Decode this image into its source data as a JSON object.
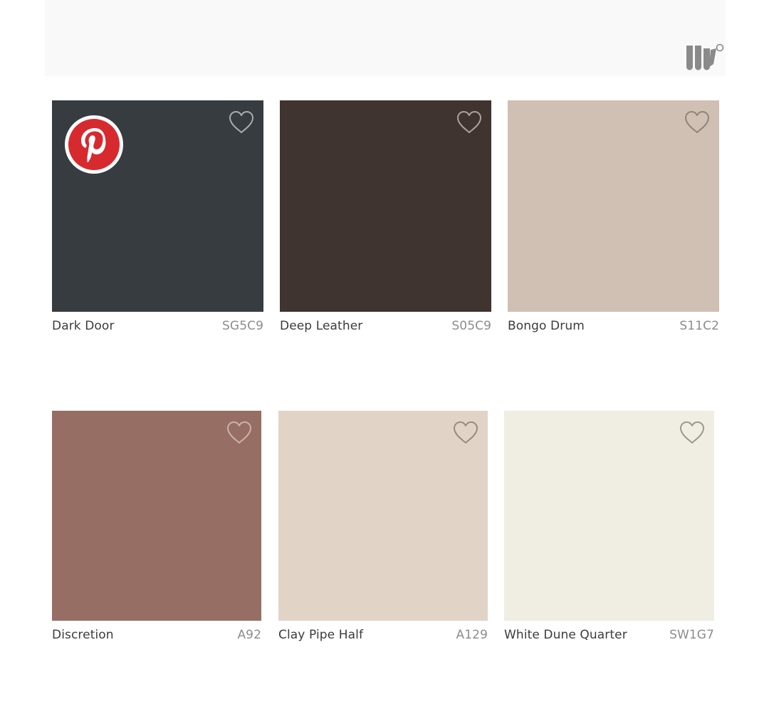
{
  "brand": {
    "logo_icon": "brand-logo-icon",
    "logo_color": "#8a8a8a"
  },
  "swatches": [
    {
      "name": "Dark Door",
      "code": "SG5C9",
      "hex": "#363c40",
      "heart_color": "#a9adb0",
      "pinterest": true
    },
    {
      "name": "Deep Leather",
      "code": "S05C9",
      "hex": "#403431",
      "heart_color": "#aba39f",
      "pinterest": false
    },
    {
      "name": "Bongo Drum",
      "code": "S11C2",
      "hex": "#cfc0b3",
      "heart_color": "#8e8478",
      "pinterest": false
    },
    {
      "name": "Discretion",
      "code": "A92",
      "hex": "#976e64",
      "heart_color": "#c9b3ac",
      "pinterest": false
    },
    {
      "name": "Clay Pipe Half",
      "code": "A129",
      "hex": "#e1d4c7",
      "heart_color": "#978a7f",
      "pinterest": false
    },
    {
      "name": "White Dune Quarter",
      "code": "SW1G7",
      "hex": "#f0ede2",
      "heart_color": "#9a988f",
      "pinterest": false
    }
  ],
  "icons": {
    "favorite": "heart-outline-icon",
    "share": "pinterest-icon"
  },
  "pinterest_color": "#d62a2f"
}
